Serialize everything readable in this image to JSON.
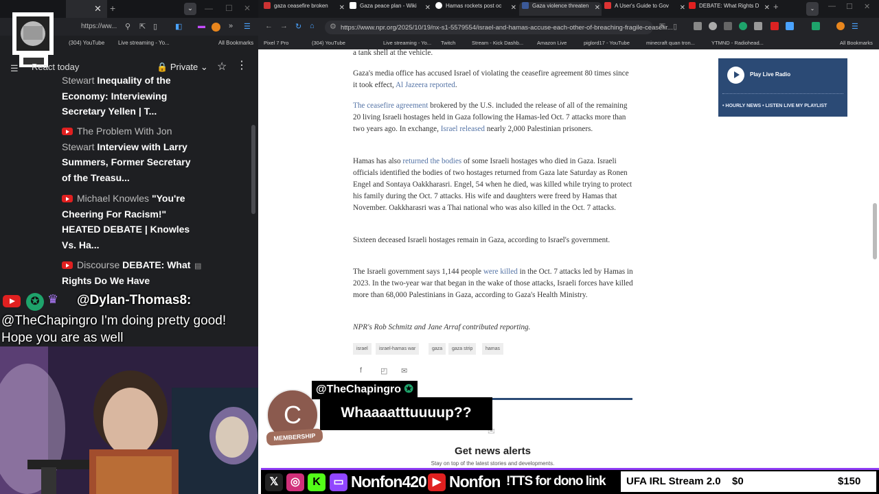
{
  "left_browser": {
    "url": "https://ww...",
    "bookmarks": [
      "(304) YouTube",
      "Live streaming - Yo...",
      "All Bookmarks"
    ],
    "toolbar": {
      "title": "React today",
      "private_label": "Private"
    },
    "feed": [
      {
        "channel": "Stewart",
        "title": "Inequality of the Economy: Interviewing Secretary Yellen | T..."
      },
      {
        "channel": "The Problem With Jon Stewart",
        "title": "Interview with Larry Summers, Former Secretary of the Treasu..."
      },
      {
        "channel": "Michael Knowles",
        "title": "\"You're Cheering For Racism!\" HEATED DEBATE | Knowles Vs. Ha..."
      },
      {
        "channel": "Discourse",
        "title": "DEBATE: What Rights Do We Have"
      }
    ]
  },
  "chat": {
    "username": "@Dylan-Thomas8:",
    "message": "@TheChapingro I'm doing pretty good! Hope you are as well"
  },
  "right_browser": {
    "tabs": [
      {
        "title": "gaza ceasefire broken",
        "color": "#cc3333"
      },
      {
        "title": "Gaza peace plan - Wiki",
        "color": "#ffffff"
      },
      {
        "title": "Hamas rockets post oc",
        "color": "#444444"
      },
      {
        "title": "Gaza violence threaten",
        "color": "#3b5998"
      },
      {
        "title": "A User's Guide to Gov",
        "color": "#d33"
      },
      {
        "title": "DEBATE: What Rights D",
        "color": "#e02020"
      }
    ],
    "url": "https://www.npr.org/2025/10/19/nx-s1-5579554/israel-and-hamas-accuse-each-other-of-breaching-fragile-ceasefir...",
    "bookmarks": [
      "Pixel 7 Pro",
      "(304) YouTube",
      "Live streaming - Yo...",
      "Twitch",
      "Stream - Kick Dashb...",
      "Amazon Live",
      "piglord17 - YouTube",
      "minecraft quan tron...",
      "YTMND - Radiohead...",
      "All Bookmarks"
    ]
  },
  "article": {
    "p0": "a tank shell at the vehicle.",
    "p1_a": "Gaza's media office has accused Israel of violating the ceasefire agreement 80 times since it took effect, ",
    "p1_link": "Al Jazeera reported",
    "p1_b": ".",
    "p2_link1": "The ceasefire agreement",
    "p2_a": " brokered by the U.S. included the release of all of the remaining 20 living Israeli hostages held in Gaza following the Hamas-led Oct. 7 attacks more than two years ago. In exchange, ",
    "p2_link2": "Israel released",
    "p2_b": " nearly 2,000 Palestinian prisoners.",
    "p3_a": "Hamas has also ",
    "p3_link": "returned the bodies",
    "p3_b": " of some Israeli hostages who died in Gaza. Israeli officials identified the bodies of two hostages returned from Gaza late Saturday as Ronen Engel and Sontaya Oakkharasri. Engel, 54 when he died, was killed while trying to protect his family during the Oct. 7 attacks. His wife and daughters were freed by Hamas that November. Oakkharasri was a Thai national who was also killed in the Oct. 7 attacks.",
    "p4": "Sixteen deceased Israeli hostages remain in Gaza, according to Israel's government.",
    "p5_a": "The Israeli government says 1,144 people ",
    "p5_link": "were killed",
    "p5_b": " in the Oct. 7 attacks led by Hamas in 2023. In the two-year war that began in the wake of those attacks, Israeli forces have killed more than 68,000 Palestinians in Gaza, according to Gaza's Health Ministry.",
    "credit": "NPR's Rob Schmitz and Jane Arraf contributed reporting.",
    "tags": [
      "israel",
      "israel-hamas war",
      "gaza",
      "gaza strip",
      "hamas"
    ],
    "alerts_title": "Get news alerts",
    "alerts_sub": "Stay on top of the latest stories and developments."
  },
  "radio": {
    "title": "Play Live Radio",
    "links": "• HOURLY NEWS   • LISTEN LIVE   MY PLAYLIST"
  },
  "membership": {
    "initial": "C",
    "user": "@TheChapingro",
    "message": "Whaaaatttuuuup??",
    "badge": "MEMBERSHIP"
  },
  "stream_bar": {
    "name1": "Nonfon420",
    "name2": "Nonfon",
    "tts": "!TTS for dono link",
    "goal_title": "UFA IRL Stream 2.0",
    "goal_current": "$0",
    "goal_target": "$150"
  },
  "colors": {
    "accent": "#8f3cf5",
    "npr_blue": "#2b4a75",
    "link": "#5574a6"
  }
}
